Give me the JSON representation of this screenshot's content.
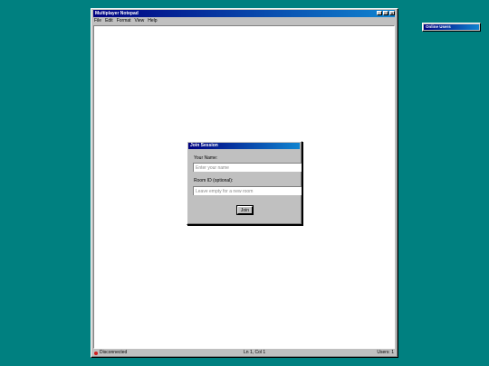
{
  "window": {
    "title": "Multiplayer Notepad",
    "buttons": {
      "minimize": "_",
      "maximize": "□",
      "close": "×"
    },
    "menu": [
      "File",
      "Edit",
      "Format",
      "View",
      "Help"
    ]
  },
  "status": {
    "connection": "Disconnected",
    "position": "Ln 1, Col 1",
    "users": "Users: 1"
  },
  "dialog": {
    "title": "Join Session",
    "name_label": "Your Name:",
    "name_placeholder": "Enter your name",
    "room_label": "Room ID (optional):",
    "room_placeholder": "Leave empty for a new room",
    "join_label": "Join"
  },
  "online_panel": {
    "title": "Online Users"
  },
  "colors": {
    "desktop": "#008080",
    "titlebar": "#000080",
    "status_dot": "#d02020"
  }
}
